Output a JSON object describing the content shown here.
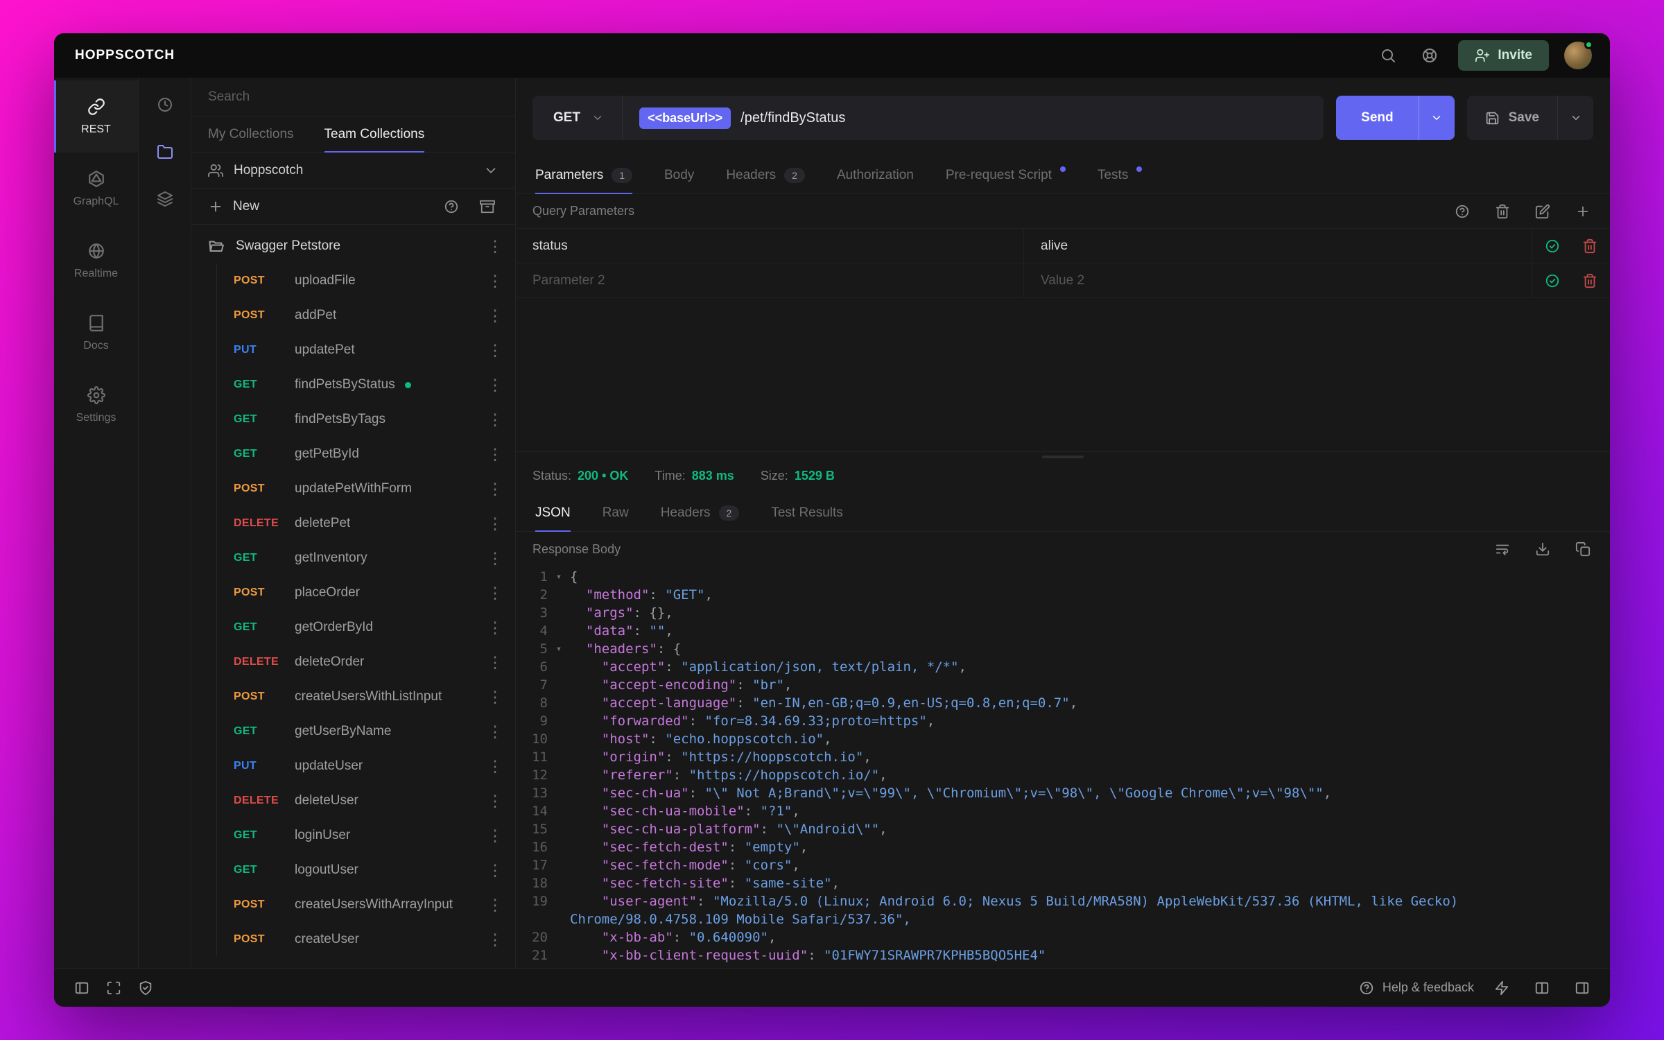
{
  "topbar": {
    "logo": "HOPPSCOTCH",
    "invite_label": "Invite"
  },
  "nav": {
    "items": [
      {
        "label": "REST",
        "active": true
      },
      {
        "label": "GraphQL"
      },
      {
        "label": "Realtime"
      },
      {
        "label": "Docs"
      },
      {
        "label": "Settings"
      }
    ]
  },
  "collections": {
    "search_placeholder": "Search",
    "tabs": [
      {
        "label": "My Collections"
      },
      {
        "label": "Team Collections",
        "active": true
      }
    ],
    "team_name": "Hoppscotch",
    "new_label": "New",
    "folder_name": "Swagger Petstore",
    "requests": [
      {
        "method": "POST",
        "name": "uploadFile"
      },
      {
        "method": "POST",
        "name": "addPet"
      },
      {
        "method": "PUT",
        "name": "updatePet"
      },
      {
        "method": "GET",
        "name": "findPetsByStatus",
        "active": true
      },
      {
        "method": "GET",
        "name": "findPetsByTags"
      },
      {
        "method": "GET",
        "name": "getPetById"
      },
      {
        "method": "POST",
        "name": "updatePetWithForm"
      },
      {
        "method": "DELETE",
        "name": "deletePet"
      },
      {
        "method": "GET",
        "name": "getInventory"
      },
      {
        "method": "POST",
        "name": "placeOrder"
      },
      {
        "method": "GET",
        "name": "getOrderById"
      },
      {
        "method": "DELETE",
        "name": "deleteOrder"
      },
      {
        "method": "POST",
        "name": "createUsersWithListInput"
      },
      {
        "method": "GET",
        "name": "getUserByName"
      },
      {
        "method": "PUT",
        "name": "updateUser"
      },
      {
        "method": "DELETE",
        "name": "deleteUser"
      },
      {
        "method": "GET",
        "name": "loginUser"
      },
      {
        "method": "GET",
        "name": "logoutUser"
      },
      {
        "method": "POST",
        "name": "createUsersWithArrayInput"
      },
      {
        "method": "POST",
        "name": "createUser"
      }
    ]
  },
  "request": {
    "method": "GET",
    "base_url_chip": "<<baseUrl>>",
    "path": "/pet/findByStatus",
    "send_label": "Send",
    "save_label": "Save",
    "tabs": {
      "parameters": {
        "label": "Parameters",
        "badge": "1"
      },
      "body": {
        "label": "Body"
      },
      "headers": {
        "label": "Headers",
        "badge": "2"
      },
      "authorization": {
        "label": "Authorization"
      },
      "prerequest": {
        "label": "Pre-request Script",
        "dot": true
      },
      "tests": {
        "label": "Tests",
        "dot": true
      }
    },
    "section_title": "Query Parameters",
    "params": [
      {
        "key": "status",
        "value": "alive"
      },
      {
        "key_placeholder": "Parameter 2",
        "value_placeholder": "Value 2"
      }
    ]
  },
  "response": {
    "status_label": "Status:",
    "status_value": "200 • OK",
    "time_label": "Time:",
    "time_value": "883 ms",
    "size_label": "Size:",
    "size_value": "1529 B",
    "tabs": {
      "json": {
        "label": "JSON"
      },
      "raw": {
        "label": "Raw"
      },
      "headers": {
        "label": "Headers",
        "badge": "2"
      },
      "tests": {
        "label": "Test Results"
      }
    },
    "body_title": "Response Body",
    "code_lines": [
      {
        "n": "1",
        "fold": true,
        "text": "{"
      },
      {
        "n": "2",
        "text": "  \"method\": \"GET\","
      },
      {
        "n": "3",
        "text": "  \"args\": {},"
      },
      {
        "n": "4",
        "text": "  \"data\": \"\","
      },
      {
        "n": "5",
        "fold": true,
        "text": "  \"headers\": {"
      },
      {
        "n": "6",
        "text": "    \"accept\": \"application/json, text/plain, */*\","
      },
      {
        "n": "7",
        "text": "    \"accept-encoding\": \"br\","
      },
      {
        "n": "8",
        "text": "    \"accept-language\": \"en-IN,en-GB;q=0.9,en-US;q=0.8,en;q=0.7\","
      },
      {
        "n": "9",
        "text": "    \"forwarded\": \"for=8.34.69.33;proto=https\","
      },
      {
        "n": "10",
        "text": "    \"host\": \"echo.hoppscotch.io\","
      },
      {
        "n": "11",
        "text": "    \"origin\": \"https://hoppscotch.io\","
      },
      {
        "n": "12",
        "text": "    \"referer\": \"https://hoppscotch.io/\","
      },
      {
        "n": "13",
        "text": "    \"sec-ch-ua\": \"\\\" Not A;Brand\\\";v=\\\"99\\\", \\\"Chromium\\\";v=\\\"98\\\", \\\"Google Chrome\\\";v=\\\"98\\\"\","
      },
      {
        "n": "14",
        "text": "    \"sec-ch-ua-mobile\": \"?1\","
      },
      {
        "n": "15",
        "text": "    \"sec-ch-ua-platform\": \"\\\"Android\\\"\","
      },
      {
        "n": "16",
        "text": "    \"sec-fetch-dest\": \"empty\","
      },
      {
        "n": "17",
        "text": "    \"sec-fetch-mode\": \"cors\","
      },
      {
        "n": "18",
        "text": "    \"sec-fetch-site\": \"same-site\","
      },
      {
        "n": "19",
        "text": "    \"user-agent\": \"Mozilla/5.0 (Linux; Android 6.0; Nexus 5 Build/MRA58N) AppleWebKit/537.36 (KHTML, like Gecko)"
      },
      {
        "n": "",
        "cont": true,
        "text": "Chrome/98.0.4758.109 Mobile Safari/537.36\","
      },
      {
        "n": "20",
        "text": "    \"x-bb-ab\": \"0.640090\","
      },
      {
        "n": "21",
        "text": "    \"x-bb-client-request-uuid\": \"01FWY71SRAWPR7KPHB5BQO5HE4\""
      }
    ]
  },
  "footer": {
    "help_label": "Help & feedback"
  },
  "colors": {
    "accent": "#6366f1",
    "get": "#10b981",
    "post": "#ef9b40",
    "put": "#3b82f6",
    "delete": "#e04c4c",
    "success": "#10b981"
  },
  "icons": {
    "kebab-icon": "⋮",
    "fold-arrow-icon": "▾"
  }
}
